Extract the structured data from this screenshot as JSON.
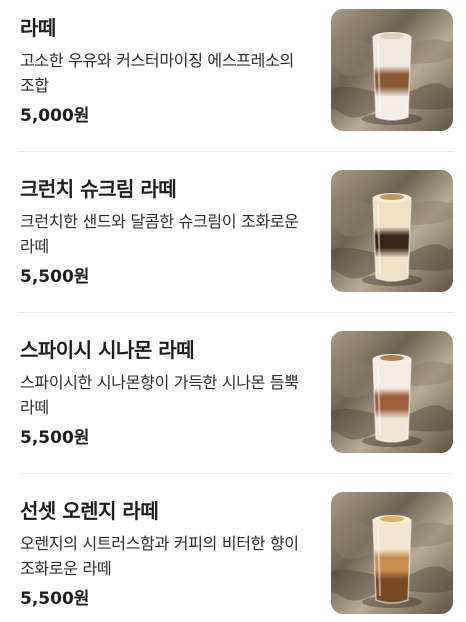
{
  "menu": {
    "items": [
      {
        "name": "라떼",
        "description": "고소한 우유와 커스터마이징 에스프레소의 조합",
        "price": "5,000원",
        "photo_icon": "latte-photo",
        "drink_colors": {
          "top": "#efe8de",
          "mid": "#8a5a36",
          "bottom": "#f3eee6",
          "foam": "#f1e7da",
          "topping": "#d9cbb8"
        }
      },
      {
        "name": "크런치 슈크림 라떼",
        "description": "크런치한 샌드와 달콤한 슈크림이 조화로운 라떼",
        "price": "5,500원",
        "photo_icon": "crunch-cream-latte-photo",
        "drink_colors": {
          "top": "#f0e0c2",
          "mid": "#3b2418",
          "bottom": "#f0e2c6",
          "foam": "#f5ead4",
          "topping": "#b9874c"
        }
      },
      {
        "name": "스파이시 시나몬 라떼",
        "description": "스파이시한 시나몬향이 가득한 시나몬 듬뿍 라떼",
        "price": "5,500원",
        "photo_icon": "spicy-cinnamon-latte-photo",
        "drink_colors": {
          "top": "#f4ece2",
          "mid": "#9b5f3a",
          "bottom": "#efe6da",
          "foam": "#f7efe4",
          "topping": "#a46a3e"
        }
      },
      {
        "name": "선셋 오렌지 라떼",
        "description": "오렌지의 시트러스함과 커피의 비터한 향이 조화로운 라떼",
        "price": "5,500원",
        "photo_icon": "sunset-orange-latte-photo",
        "drink_colors": {
          "top": "#f2e6d2",
          "mid": "#c98e4e",
          "bottom": "#7a4a24",
          "foam": "#f7ecd9",
          "topping": "#e2a54c"
        }
      }
    ]
  }
}
